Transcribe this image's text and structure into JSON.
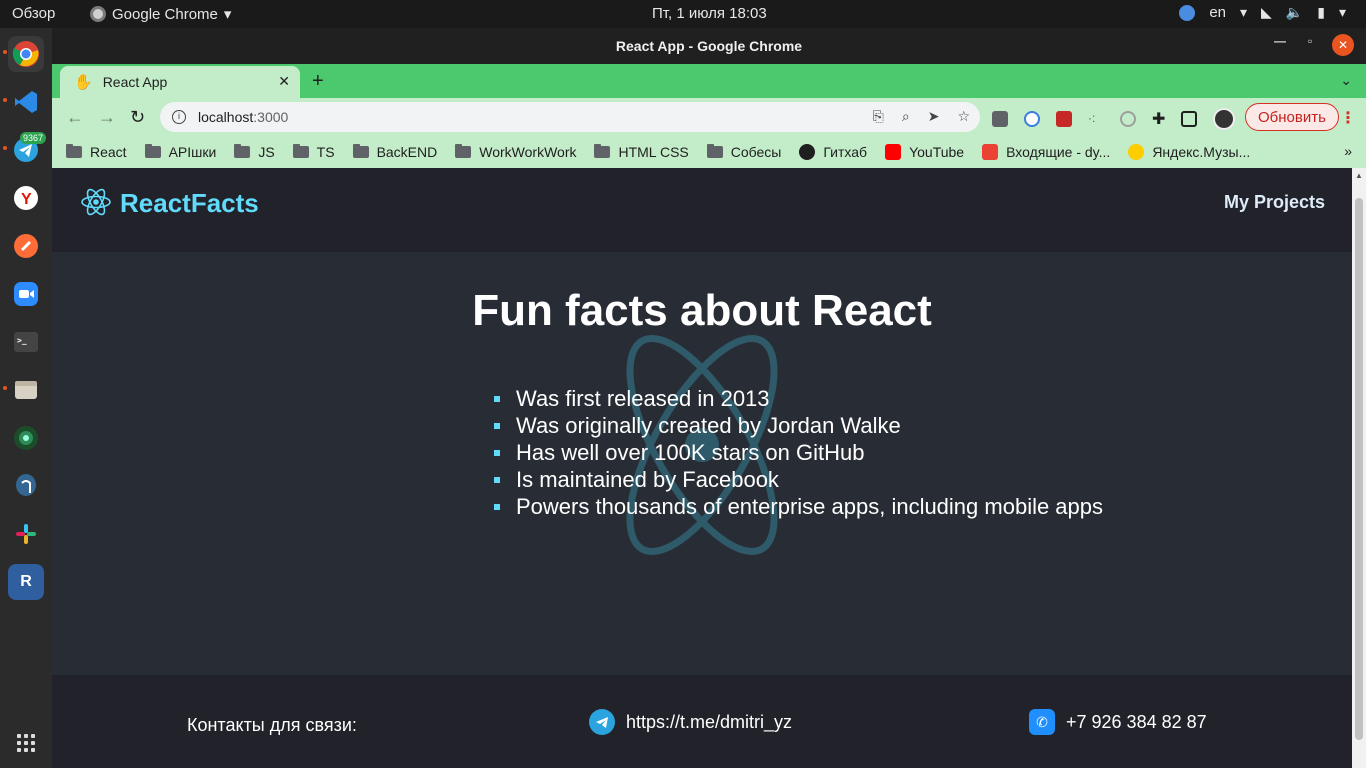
{
  "os": {
    "activities": "Обзор",
    "app_name": "Google Chrome",
    "clock": "Пт, 1 июля  18:03",
    "keyboard_layout": "en",
    "telegram_badge": "9367"
  },
  "window": {
    "title": "React App - Google Chrome",
    "tab_title": "React App",
    "url_host": "localhost",
    "url_port": ":3000",
    "update_button": "Обновить"
  },
  "bookmarks": [
    {
      "label": "React",
      "type": "folder"
    },
    {
      "label": "APIшки",
      "type": "folder"
    },
    {
      "label": "JS",
      "type": "folder"
    },
    {
      "label": "TS",
      "type": "folder"
    },
    {
      "label": "BackEND",
      "type": "folder"
    },
    {
      "label": "WorkWorkWork",
      "type": "folder"
    },
    {
      "label": "HTML CSS",
      "type": "folder"
    },
    {
      "label": "Собесы",
      "type": "folder"
    },
    {
      "label": "Гитхаб",
      "type": "github"
    },
    {
      "label": "YouTube",
      "type": "youtube"
    },
    {
      "label": "Входящие - dy...",
      "type": "gmail"
    },
    {
      "label": "Яндекс.Музы...",
      "type": "yandex-music"
    }
  ],
  "site": {
    "brand": "ReactFacts",
    "nav_link": "My Projects",
    "heading": "Fun facts about React",
    "facts": [
      "Was first released in 2013",
      "Was originally created by Jordan Walke",
      "Has well over 100K stars on GitHub",
      "Is maintained by Facebook",
      "Powers thousands of enterprise apps, including mobile apps"
    ],
    "footer": {
      "contacts_label": "Контакты для связи:",
      "telegram": "https://t.me/dmitri_yz",
      "phone": "+7 926 384 82 87"
    }
  },
  "colors": {
    "accent": "#61dafb",
    "nav_bg": "#21222a",
    "main_bg": "#282d35",
    "tab_strip": "#4cc96e"
  }
}
